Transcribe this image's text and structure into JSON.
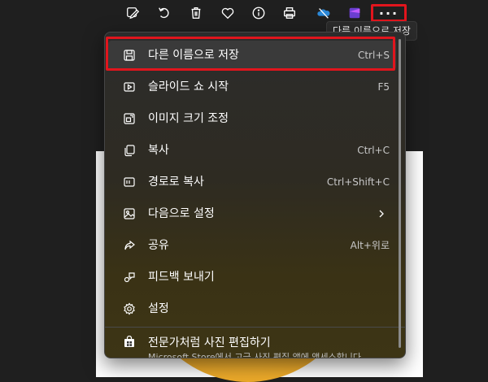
{
  "toolbar": {
    "buttons": [
      {
        "name": "edit-image-icon"
      },
      {
        "name": "rotate-icon"
      },
      {
        "name": "delete-icon"
      },
      {
        "name": "favorite-icon"
      },
      {
        "name": "info-icon"
      },
      {
        "name": "print-icon"
      },
      {
        "name": "onedrive-icon"
      },
      {
        "name": "clipchamp-icon"
      }
    ],
    "more_label": "···",
    "tooltip": "다른 이름으로 저장"
  },
  "menu": {
    "items": [
      {
        "label": "다른 이름으로 저장",
        "shortcut": "Ctrl+S",
        "icon": "save-icon"
      },
      {
        "label": "슬라이드 쇼 시작",
        "shortcut": "F5",
        "icon": "slideshow-icon"
      },
      {
        "label": "이미지 크기 조정",
        "shortcut": "",
        "icon": "resize-icon"
      },
      {
        "label": "복사",
        "shortcut": "Ctrl+C",
        "icon": "copy-icon"
      },
      {
        "label": "경로로 복사",
        "shortcut": "Ctrl+Shift+C",
        "icon": "copy-path-icon"
      },
      {
        "label": "다음으로 설정",
        "shortcut": "",
        "icon": "set-as-icon"
      },
      {
        "label": "공유",
        "shortcut": "Alt+위로",
        "icon": "share-icon"
      },
      {
        "label": "피드백 보내기",
        "shortcut": "",
        "icon": "feedback-icon"
      },
      {
        "label": "설정",
        "shortcut": "",
        "icon": "settings-icon"
      }
    ],
    "store": {
      "title": "전문가처럼 사진 편집하기",
      "subtitle": "Microsoft Store에서 고급 사진 편집 앱에 액세스합니다"
    }
  },
  "colors": {
    "highlight_outline": "#e1151d",
    "menu_bg": "#2c2c2c",
    "accent_yellow": "#f2b233"
  }
}
